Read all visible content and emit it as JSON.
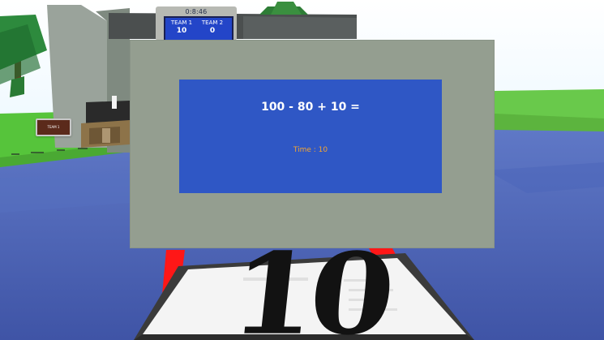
{
  "scoreboard": {
    "clock": "0:8:46",
    "team1": {
      "name": "TEAM 1",
      "score": "10"
    },
    "team2": {
      "name": "TEAM 2",
      "score": "0"
    }
  },
  "world_sign": "TEAM 1",
  "quiz": {
    "question": "100 - 80 + 10 =",
    "timer": "Time : 10"
  },
  "floor_pad": {
    "number": "10"
  },
  "colors": {
    "sky": "#e9f7ff",
    "water": "#4f67b7",
    "quiz_board": "#949e90",
    "quiz_screen": "#2f57c5",
    "timer_text": "#f4a531",
    "pointer": "#ff1a1a"
  },
  "icons": [
    "tree",
    "platform",
    "red-pointer"
  ]
}
